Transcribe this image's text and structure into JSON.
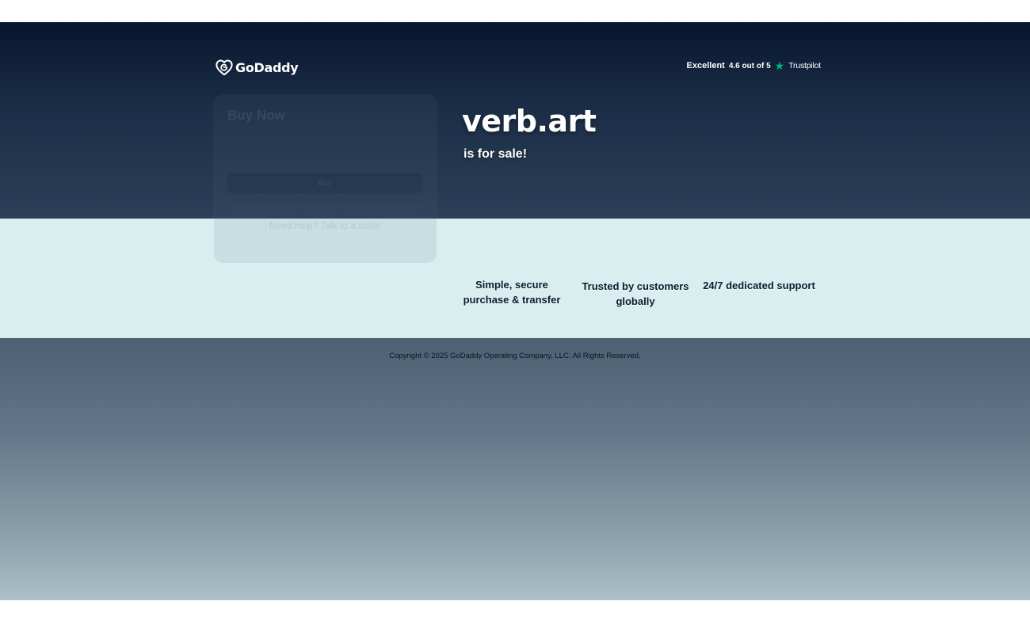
{
  "brand": {
    "logo_text": "GoDaddy",
    "logo_icon": "godaddy-heart-icon"
  },
  "trustpilot": {
    "rating_word": "Excellent",
    "score_text": "4.6 out of 5",
    "star_icon": "star-icon",
    "brand": "Trustpilot",
    "star_color": "#00b67a"
  },
  "hero": {
    "domain": "verb.art",
    "subtitle": "is for sale!"
  },
  "card": {
    "title": "Buy Now",
    "subtitle": "",
    "price": "",
    "button_label": "Buy",
    "help_text": "Need help? Talk to a seller",
    "phone": ""
  },
  "benefits": [
    {
      "icon": "secure-lock-icon",
      "text": "Simple, secure purchase & transfer"
    },
    {
      "icon": "customers-globe-icon",
      "text": "Trusted by customers globally"
    },
    {
      "icon": "support-headset-icon",
      "text": "24/7 dedicated support"
    }
  ],
  "footer": {
    "copyright": "Copyright © 2025 GoDaddy Operating Company, LLC. All Rights Reserved."
  },
  "colors": {
    "hero_top": "#07162d",
    "hero_bottom": "#2b3f58",
    "benefits_band": "#d8eeef",
    "footer_top": "#4e6073",
    "footer_bottom": "#abc0c7"
  }
}
